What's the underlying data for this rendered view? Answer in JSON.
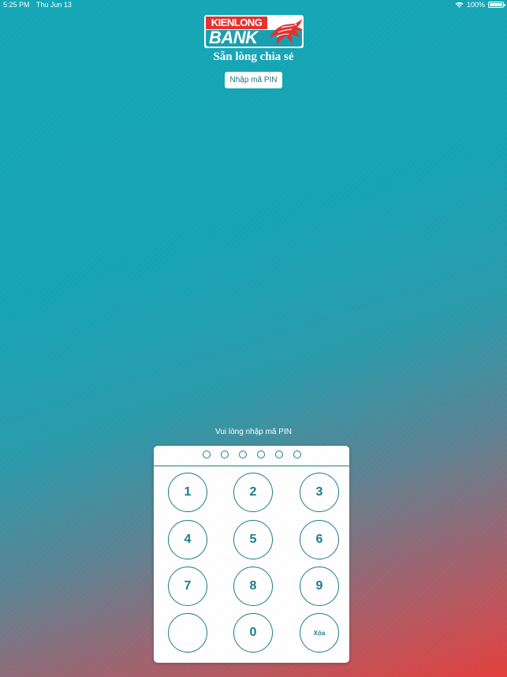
{
  "status_bar": {
    "time": "5:25 PM",
    "date": "Thu Jun 13",
    "battery": "100%",
    "battery_level": 1.0
  },
  "logo": {
    "line1": "KIENLONG",
    "line2": "BANK",
    "brand_red": "#e5322f",
    "brand_teal": "#1a9fb0"
  },
  "slogan": "Sẵn lòng chia sẻ",
  "pin_button_label": "Nhập mã PIN",
  "prompt": "Vui lòng nhập mã PIN",
  "pin": {
    "length": 6,
    "entered": 0
  },
  "keypad": {
    "keys": [
      "1",
      "2",
      "3",
      "4",
      "5",
      "6",
      "7",
      "8",
      "9",
      "",
      "0",
      "Xóa"
    ]
  },
  "colors": {
    "gradient_start": "#15a7b6",
    "gradient_end": "#e4403e",
    "keypad_accent": "#1c7d8b"
  },
  "icons": [
    "wifi-icon",
    "battery-icon",
    "dragon-icon"
  ]
}
